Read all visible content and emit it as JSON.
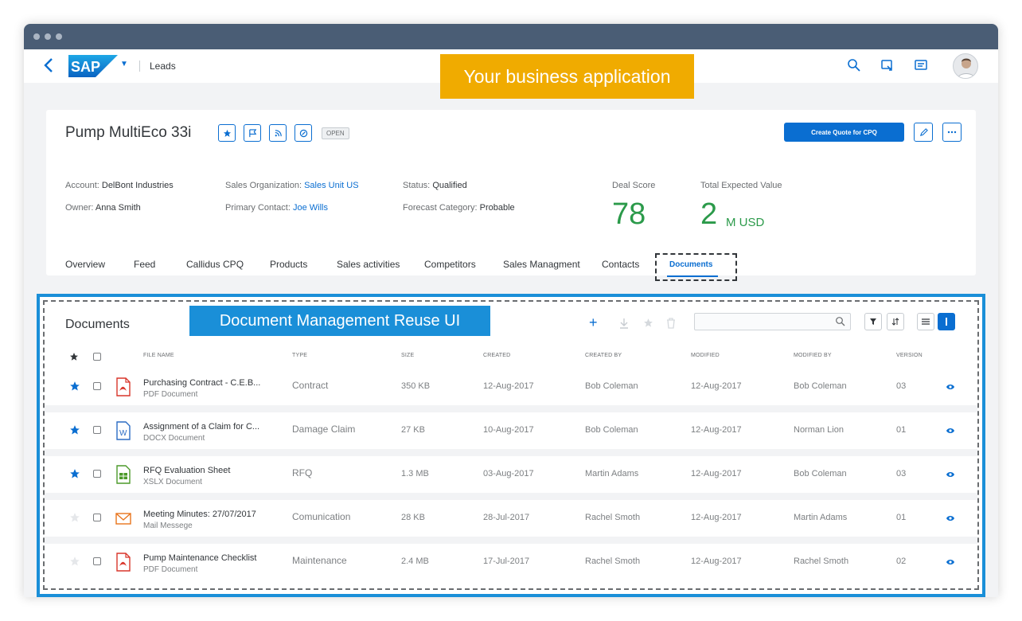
{
  "shell": {
    "brand": "SAP",
    "app_title": "Leads"
  },
  "annotations": {
    "business_app": "Your business application",
    "reuse_ui": "Document Management Reuse UI"
  },
  "header": {
    "title": "Pump MultiEco 33i",
    "status_badge": "OPEN",
    "primary_action": "Create Quote for CPQ",
    "attributes": {
      "account_label": "Account:",
      "account_value": "DelBont Industries",
      "owner_label": "Owner:",
      "owner_value": "Anna Smith",
      "sales_org_label": "Sales Organization:",
      "sales_org_value": "Sales Unit US",
      "primary_contact_label": "Primary Contact:",
      "primary_contact_value": "Joe Wills",
      "status_label": "Status:",
      "status_value": "Qualified",
      "forecast_label": "Forecast Category:",
      "forecast_value": "Probable"
    },
    "kpis": {
      "deal_score_label": "Deal Score",
      "deal_score_value": "78",
      "expected_label": "Total Expected Value",
      "expected_value": "2",
      "expected_unit": "M USD"
    },
    "tabs": [
      "Overview",
      "Feed",
      "Callidus CPQ",
      "Products",
      "Sales activities",
      "Competitors",
      "Sales Managment",
      "Contacts",
      "Documents"
    ]
  },
  "documents": {
    "title": "Documents",
    "search_placeholder": "",
    "columns": [
      "File Name",
      "Type",
      "Size",
      "Created",
      "Created By",
      "Modified",
      "Modified By",
      "Version"
    ],
    "rows": [
      {
        "name": "Purchasing Contract - C.E.B...",
        "ftype": "PDF Document",
        "type": "Contract",
        "size": "350 KB",
        "created": "12-Aug-2017",
        "created_by": "Bob Coleman",
        "modified": "12-Aug-2017",
        "modified_by": "Bob Coleman",
        "version": "03",
        "starred": true,
        "icon": "pdf-file-icon"
      },
      {
        "name": "Assignment of a Claim for C...",
        "ftype": "DOCX Document",
        "type": "Damage Claim",
        "size": "27 KB",
        "created": "10-Aug-2017",
        "created_by": "Bob Coleman",
        "modified": "12-Aug-2017",
        "modified_by": "Norman Lion",
        "version": "01",
        "starred": true,
        "icon": "word-file-icon"
      },
      {
        "name": "RFQ Evaluation Sheet",
        "ftype": "XSLX Document",
        "type": "RFQ",
        "size": "1.3 MB",
        "created": "03-Aug-2017",
        "created_by": "Martin Adams",
        "modified": "12-Aug-2017",
        "modified_by": "Bob Coleman",
        "version": "03",
        "starred": true,
        "icon": "excel-file-icon"
      },
      {
        "name": "Meeting Minutes: 27/07/2017",
        "ftype": "Mail Messege",
        "type": "Comunication",
        "size": "28 KB",
        "created": "28-Jul-2017",
        "created_by": "Rachel Smoth",
        "modified": "12-Aug-2017",
        "modified_by": "Martin Adams",
        "version": "01",
        "starred": false,
        "icon": "mail-file-icon"
      },
      {
        "name": "Pump Maintenance Checklist",
        "ftype": "PDF Document",
        "type": "Maintenance",
        "size": "2.4 MB",
        "created": "17-Jul-2017",
        "created_by": "Rachel Smoth",
        "modified": "12-Aug-2017",
        "modified_by": "Rachel Smoth",
        "version": "02",
        "starred": false,
        "icon": "pdf-file-icon"
      }
    ]
  },
  "colors": {
    "brand_blue": "#0a6ed1",
    "kpi_green": "#2b9a4a",
    "business_banner": "#f0ab00",
    "reuse_banner": "#1a8fd8",
    "pdf_red": "#d9362b",
    "word_blue": "#2b6cc4",
    "excel_green": "#4c9a2a",
    "mail_orange": "#e8741c"
  }
}
